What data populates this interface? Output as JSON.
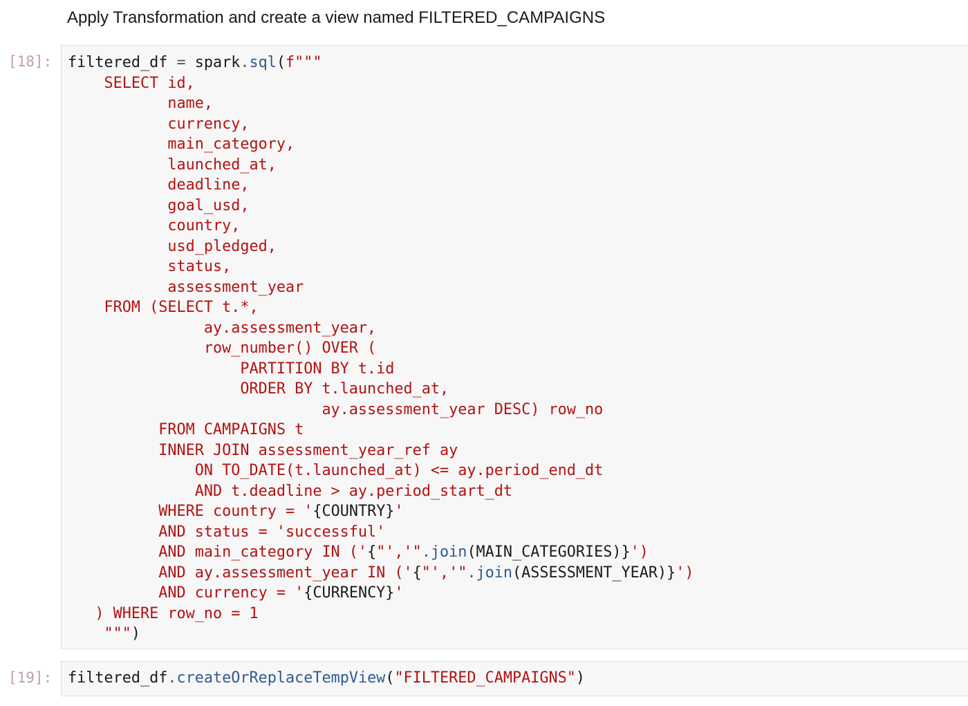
{
  "markdown": {
    "heading": "Apply Transformation and create a view named FILTERED_CAMPAIGNS"
  },
  "cells": [
    {
      "prompt": "[18]:",
      "segments": [
        {
          "t": "n",
          "v": "filtered_df "
        },
        {
          "t": "o",
          "v": "="
        },
        {
          "t": "n",
          "v": " spark"
        },
        {
          "t": "o",
          "v": "."
        },
        {
          "t": "m",
          "v": "sql"
        },
        {
          "t": "n",
          "v": "("
        },
        {
          "t": "s",
          "v": "f\"\"\"\n    SELECT id,\n           name,\n           currency,\n           main_category,\n           launched_at,\n           deadline,\n           goal_usd,\n           country,\n           usd_pledged,\n           status,\n           assessment_year\n    FROM (SELECT t.*,\n               ay.assessment_year,\n               row_number() OVER (\n                   PARTITION BY t.id\n                   ORDER BY t.launched_at,\n                            ay.assessment_year DESC) row_no\n          FROM CAMPAIGNS t\n          INNER JOIN assessment_year_ref ay\n              ON TO_DATE(t.launched_at) <= ay.period_end_dt\n              AND t.deadline > ay.period_start_dt\n          WHERE country = '"
        },
        {
          "t": "n",
          "v": "{COUNTRY}"
        },
        {
          "t": "s",
          "v": "'\n          AND status = 'successful'\n          AND main_category IN ('"
        },
        {
          "t": "n",
          "v": "{"
        },
        {
          "t": "s",
          "v": "\"','\""
        },
        {
          "t": "o",
          "v": "."
        },
        {
          "t": "m",
          "v": "join"
        },
        {
          "t": "n",
          "v": "(MAIN_CATEGORIES)}"
        },
        {
          "t": "s",
          "v": "')\n          AND ay.assessment_year IN ('"
        },
        {
          "t": "n",
          "v": "{"
        },
        {
          "t": "s",
          "v": "\"','\""
        },
        {
          "t": "o",
          "v": "."
        },
        {
          "t": "m",
          "v": "join"
        },
        {
          "t": "n",
          "v": "(ASSESSMENT_YEAR)}"
        },
        {
          "t": "s",
          "v": "')\n          AND currency = '"
        },
        {
          "t": "n",
          "v": "{CURRENCY}"
        },
        {
          "t": "s",
          "v": "'\n   ) WHERE row_no = 1\n    \"\"\""
        },
        {
          "t": "n",
          "v": ")"
        }
      ]
    },
    {
      "prompt": "[19]:",
      "segments": [
        {
          "t": "n",
          "v": "filtered_df"
        },
        {
          "t": "o",
          "v": "."
        },
        {
          "t": "m",
          "v": "createOrReplaceTempView"
        },
        {
          "t": "n",
          "v": "("
        },
        {
          "t": "s",
          "v": "\"FILTERED_CAMPAIGNS\""
        },
        {
          "t": "n",
          "v": ")"
        }
      ]
    }
  ]
}
